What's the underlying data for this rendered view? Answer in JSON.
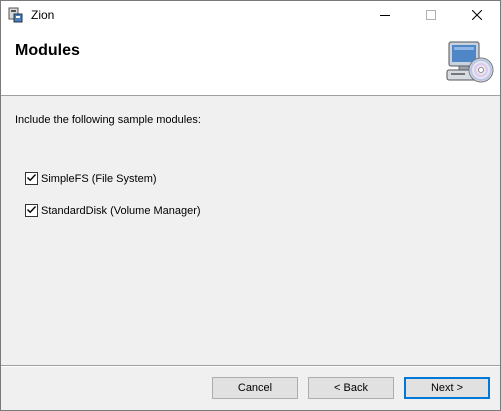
{
  "window": {
    "title": "Zion"
  },
  "banner": {
    "title": "Modules",
    "icon": "computer-cd-icon"
  },
  "content": {
    "intro": "Include the following sample modules:",
    "modules": [
      {
        "label": "SimpleFS (File System)",
        "checked": true
      },
      {
        "label": "StandardDisk (Volume Manager)",
        "checked": true
      }
    ]
  },
  "buttons": {
    "cancel": "Cancel",
    "back": "< Back",
    "next": "Next >"
  },
  "colors": {
    "accent": "#0078d7",
    "dialog_bg": "#f0f0f0"
  }
}
